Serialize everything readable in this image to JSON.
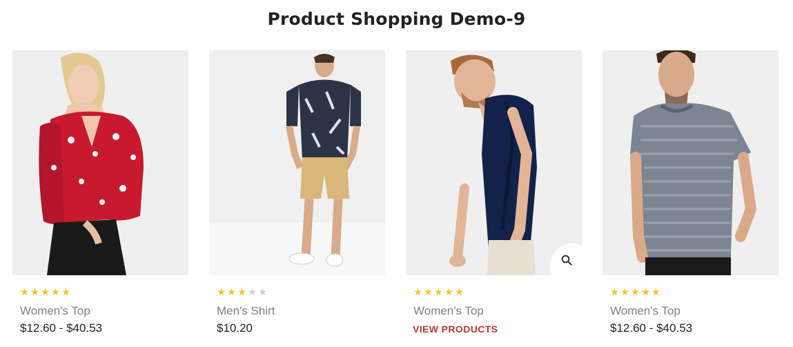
{
  "page": {
    "title": "Product Shopping Demo-9"
  },
  "colors": {
    "star_on": "#f5c518",
    "star_off": "#cfcfcf",
    "link": "#c0392b",
    "image_bg": "#eeeeee"
  },
  "products": [
    {
      "name": "Women's Top",
      "price": "$12.60 - $40.53",
      "rating": 5,
      "rating_max": 5,
      "image": "woman-red-floral-blouse"
    },
    {
      "name": "Men's Shirt",
      "price": "$10.20",
      "rating": 3,
      "rating_max": 5,
      "image": "man-printed-shirt-khaki-shorts"
    },
    {
      "name": "Women's Top",
      "action_label": "VIEW PRODUCTS",
      "rating": 5,
      "rating_max": 5,
      "image": "man-navy-polo",
      "hover_icon": "search-icon"
    },
    {
      "name": "Women's Top",
      "price": "$12.60 - $40.53",
      "rating": 5,
      "rating_max": 5,
      "image": "man-grey-striped-tshirt"
    }
  ]
}
